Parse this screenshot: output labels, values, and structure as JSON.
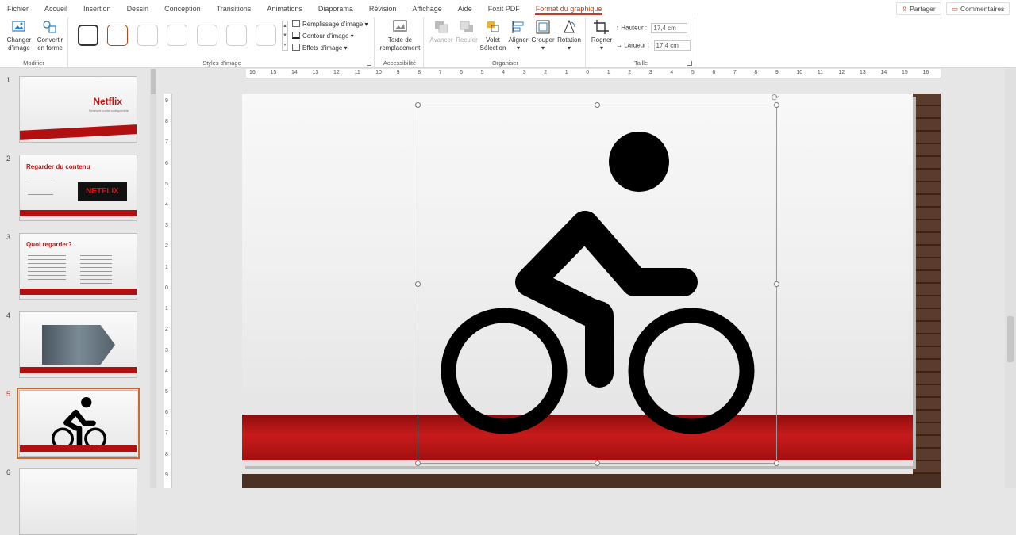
{
  "tabs": [
    "Fichier",
    "Accueil",
    "Insertion",
    "Dessin",
    "Conception",
    "Transitions",
    "Animations",
    "Diaporama",
    "Révision",
    "Affichage",
    "Aide",
    "Foxit PDF",
    "Format du graphique"
  ],
  "active_tab": "Format du graphique",
  "share_label": "Partager",
  "comments_label": "Commentaires",
  "ribbon": {
    "modifier": {
      "change_image": "Changer d'image",
      "convert_shape": "Convertir en forme",
      "label": "Modifier"
    },
    "styles": {
      "label": "Styles d'image",
      "fill": "Remplissage d'image",
      "outline": "Contour d'image",
      "effects": "Effets d'image"
    },
    "accessibility": {
      "alt_text": "Texte de remplacement",
      "label": "Accessibilité"
    },
    "organize": {
      "label": "Organiser",
      "forward": "Avancer",
      "backward": "Reculer",
      "selection": "Volet Sélection",
      "align": "Aligner",
      "group": "Grouper",
      "rotate": "Rotation"
    },
    "size": {
      "label": "Taille",
      "crop": "Rogner",
      "height_label": "Hauteur :",
      "height_value": "17,4 cm",
      "width_label": "Largeur :",
      "width_value": "17,4 cm"
    }
  },
  "ruler_h": [
    "16",
    "15",
    "14",
    "13",
    "12",
    "11",
    "10",
    "9",
    "8",
    "7",
    "6",
    "5",
    "4",
    "3",
    "2",
    "1",
    "0",
    "1",
    "2",
    "3",
    "4",
    "5",
    "6",
    "7",
    "8",
    "9",
    "10",
    "11",
    "12",
    "13",
    "14",
    "15",
    "16"
  ],
  "ruler_v": [
    "9",
    "8",
    "7",
    "6",
    "5",
    "4",
    "3",
    "2",
    "1",
    "0",
    "1",
    "2",
    "3",
    "4",
    "5",
    "6",
    "7",
    "8",
    "9"
  ],
  "slides": [
    {
      "num": "1",
      "title": "Netflix",
      "subtitle": "Séries et contenu disponible"
    },
    {
      "num": "2",
      "title": "Regarder du contenu",
      "logo": "NETFLIX"
    },
    {
      "num": "3",
      "title": "Quoi regarder?"
    },
    {
      "num": "4"
    },
    {
      "num": "5"
    },
    {
      "num": "6"
    }
  ],
  "selected_slide": "5",
  "colors": {
    "accent": "#c43e1c",
    "netflix_red": "#b01010",
    "selection": "#d2692c"
  },
  "main_icon": "cyclist-icon"
}
